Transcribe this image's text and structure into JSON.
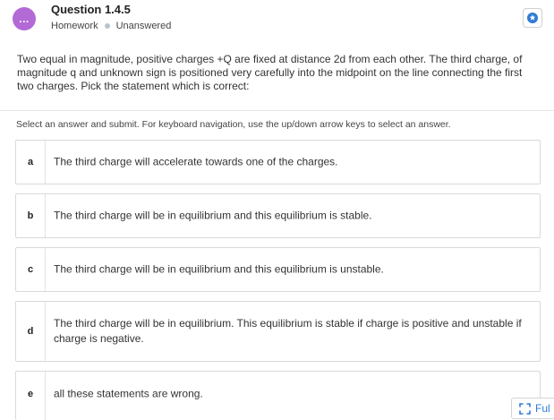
{
  "header": {
    "avatar_text": "...",
    "title": "Question 1.4.5",
    "category": "Homework",
    "status": "Unanswered",
    "bookmark_icon": "bookmark-star-icon"
  },
  "question": {
    "text": "Two equal in magnitude, positive charges +Q are fixed at distance 2d from each other. The third charge, of magnitude q and unknown sign is positioned very carefully into the midpoint on the line connecting the first two charges. Pick the statement which is correct:"
  },
  "instructions": "Select an answer and submit. For keyboard navigation, use the up/down arrow keys to select an answer.",
  "options": [
    {
      "letter": "a",
      "text": "The third charge will accelerate towards one of the charges."
    },
    {
      "letter": "b",
      "text": "The third charge will be in equilibrium and this equilibrium is stable."
    },
    {
      "letter": "c",
      "text": "The third charge will be in equilibrium and this equilibrium is unstable."
    },
    {
      "letter": "d",
      "text": "The third charge will be in equilibrium. This equilibrium is stable if charge is positive and unstable if charge is negative."
    },
    {
      "letter": "e",
      "text": "all these statements are wrong."
    }
  ],
  "fullscreen_label": "Ful",
  "colors": {
    "avatar": "#b36ad6",
    "accent": "#2f7bd5"
  }
}
